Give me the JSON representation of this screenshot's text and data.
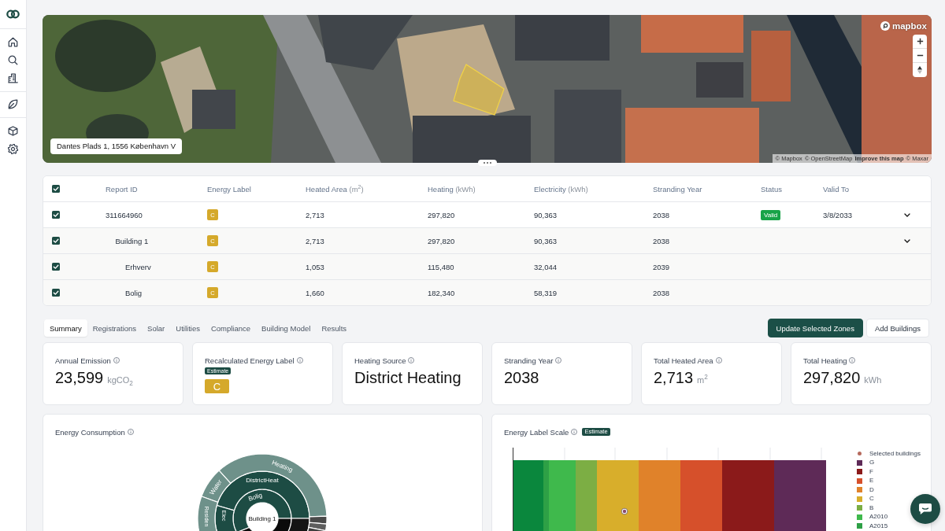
{
  "map": {
    "address": "Dantes Plads 1, 1556 København V",
    "logo": "mapbox",
    "attribution": [
      {
        "text": "© Mapbox",
        "bold": false
      },
      {
        "text": "© OpenStreetMap",
        "bold": false
      },
      {
        "text": "Improve this map",
        "bold": true
      },
      {
        "text": "© Maxar",
        "bold": false
      }
    ]
  },
  "table": {
    "all_checked": true,
    "columns": [
      {
        "label": "Report ID"
      },
      {
        "label": "Energy Label"
      },
      {
        "label": "Heated Area",
        "unit": "(m$^{2}$)"
      },
      {
        "label": "Heating",
        "unit": "(kWh)"
      },
      {
        "label": "Electricity",
        "unit": "(kWh)"
      },
      {
        "label": "Stranding Year"
      },
      {
        "label": "Status"
      },
      {
        "label": "Valid To"
      }
    ],
    "rows": [
      {
        "checked": true,
        "report_id": "311664960",
        "energy_label": {
          "grade": "C",
          "color": "#d5a92b"
        },
        "heated_area": "2,713",
        "heating": "297,820",
        "electricity": "90,363",
        "stranding_year": "2038",
        "status": {
          "text": "Valid",
          "color": "#18a348"
        },
        "valid_to": "3/8/2033",
        "expanded": true,
        "children": [
          {
            "checked": true,
            "report_id": "Building 1",
            "energy_label": {
              "grade": "C",
              "color": "#d5a92b"
            },
            "heated_area": "2,713",
            "heating": "297,820",
            "electricity": "90,363",
            "stranding_year": "2038",
            "expanded": true,
            "children": [
              {
                "checked": true,
                "report_id": "Erhverv",
                "energy_label": {
                  "grade": "C",
                  "color": "#d5a92b"
                },
                "heated_area": "1,053",
                "heating": "115,480",
                "electricity": "32,044",
                "stranding_year": "2039"
              },
              {
                "checked": true,
                "report_id": "Bolig",
                "energy_label": {
                  "grade": "C",
                  "color": "#d5a92b"
                },
                "heated_area": "1,660",
                "heating": "182,340",
                "electricity": "58,319",
                "stranding_year": "2038"
              }
            ]
          }
        ]
      }
    ]
  },
  "tabs": [
    {
      "label": "Summary",
      "selected": true
    },
    {
      "label": "Registrations",
      "selected": false
    },
    {
      "label": "Solar",
      "selected": false
    },
    {
      "label": "Utilities",
      "selected": false
    },
    {
      "label": "Compliance",
      "selected": false
    },
    {
      "label": "Building Model",
      "selected": false
    },
    {
      "label": "Results",
      "selected": false
    }
  ],
  "actions": [
    {
      "label": "Update Selected Zones",
      "kind": "primary"
    },
    {
      "label": "Add Buildings",
      "kind": "secondary"
    }
  ],
  "cards": [
    {
      "kind": "value",
      "title": "Annual Emission",
      "value": "23,599",
      "unit": "kgCO$_{2}$"
    },
    {
      "kind": "label",
      "title": "Recalculated Energy Label",
      "badge": "Estimate",
      "grade": "C",
      "color": "#d5a92b"
    },
    {
      "kind": "value",
      "title": "Heating Source",
      "value": "District Heating"
    },
    {
      "kind": "value",
      "title": "Stranding Year",
      "value": "2038"
    },
    {
      "kind": "value",
      "title": "Total Heated Area",
      "value": "2,713",
      "unit": "m$^{2}$"
    },
    {
      "kind": "value",
      "title": "Total Heating",
      "value": "297,820",
      "unit": "kWh"
    }
  ],
  "energy_consumption": {
    "title": "Energy Consumption",
    "sunburst": {
      "center": "Building 1",
      "rings": [
        [
          "Bolig"
        ],
        [
          "DistrictHeat",
          "Elec"
        ],
        [
          "Heating",
          "Water",
          "Residen"
        ]
      ]
    }
  },
  "energy_label_scale": {
    "title": "Energy Label Scale",
    "badge": "Estimate",
    "legend": [
      {
        "label": "Selected buildings",
        "kind": "dot",
        "color": "#b66a5d"
      },
      {
        "label": "G",
        "kind": "swatch",
        "color": "#5e2a57"
      },
      {
        "label": "F",
        "kind": "swatch",
        "color": "#8b1a1a"
      },
      {
        "label": "E",
        "kind": "swatch",
        "color": "#d6502b"
      },
      {
        "label": "D",
        "kind": "swatch",
        "color": "#e0822a"
      },
      {
        "label": "C",
        "kind": "swatch",
        "color": "#d8ae2b"
      },
      {
        "label": "B",
        "kind": "swatch",
        "color": "#7cae44"
      },
      {
        "label": "A2010",
        "kind": "swatch",
        "color": "#3fb94c"
      },
      {
        "label": "A2015",
        "kind": "swatch",
        "color": "#2ea046"
      }
    ]
  }
}
